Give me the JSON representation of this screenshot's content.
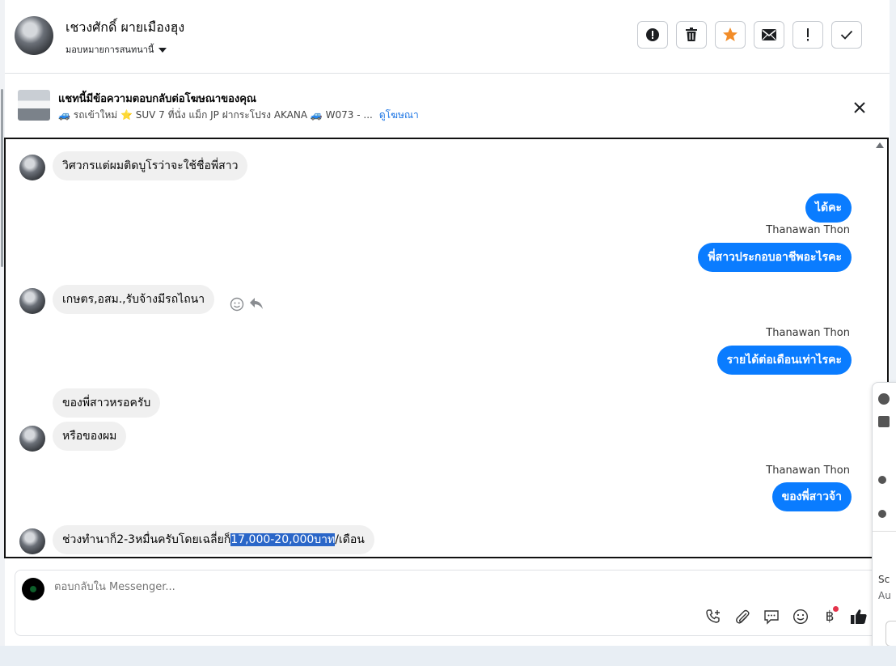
{
  "header": {
    "contact_name": "เชวงศักดิ์ ผายเมืองฮุง",
    "assign_label": "มอบหมายการสนทนานี้",
    "actions": [
      "report-icon",
      "trash-icon",
      "star-icon",
      "mail-icon",
      "exclamation-icon",
      "check-icon"
    ],
    "star_color": "#f28c28"
  },
  "ad_strip": {
    "title": "แชทนี้มีข้อความตอบกลับต่อโฆษณาของคุณ",
    "subtitle": "🚙 รถเข้าใหม่ ⭐ SUV 7 ที่นั่ง แม็ก JP ฝากระโปรง AKANA 🚙 W073 - ...",
    "link": "ดูโฆษณา"
  },
  "messages": {
    "m1": "วิศวกรแต่ผมติดบูโรว่าจะใช้ชื่อพี่สาว",
    "m2": "ได้คะ",
    "sender": "Thanawan Thon",
    "m3": "พี่สาวประกอบอาชีพอะไรคะ",
    "m4": "เกษตร,อสม.,รับจ้างมีรถไถนา",
    "m5": "รายได้ต่อเดือนเท่าไรคะ",
    "m6": "ของพี่สาวหรอครับ",
    "m7": "หรือของผม",
    "m8": "ของพี่สาวจ้า",
    "m9_pre": "ช่วงทำนาก็2-3หมื่นครับโดยเฉลี่ยก็",
    "m9_hl": "17,000-20,000บาท",
    "m9_post": "/เดือน"
  },
  "composer": {
    "placeholder": "ตอบกลับใน Messenger...",
    "tools": [
      "phone-add-icon",
      "attach-icon",
      "chat-icon",
      "emoji-icon",
      "baht-icon",
      "like-icon"
    ],
    "baht_symbol": "฿"
  },
  "side_popup": {
    "text_a": "Sc",
    "text_b": "Au"
  },
  "colors": {
    "outgoing": "#0a7cff",
    "incoming": "#f0f0f0",
    "link": "#1b74e4"
  }
}
